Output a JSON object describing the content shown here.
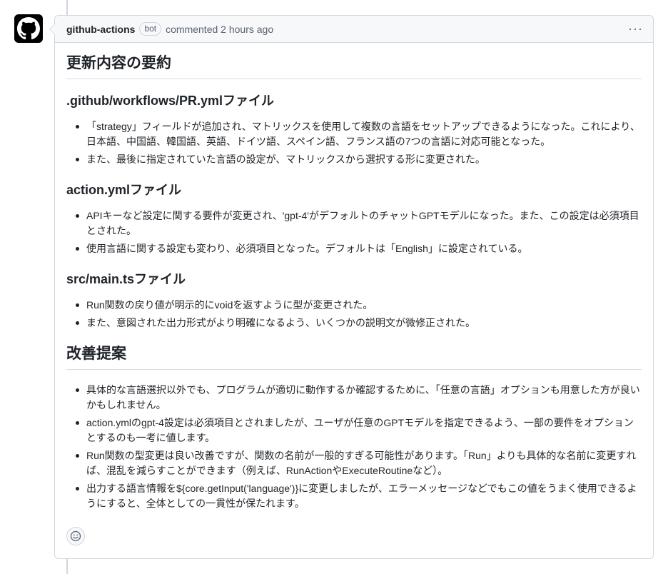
{
  "comment": {
    "author": "github-actions",
    "badge": "bot",
    "meta": "commented 2 hours ago",
    "menu_glyph": "···"
  },
  "icons": {
    "avatar": "github-mark-icon",
    "reaction": "smiley-icon"
  },
  "body": {
    "summary_heading": "更新内容の要約",
    "sections": [
      {
        "title": ".github/workflows/PR.ymlファイル",
        "items": [
          "「strategy」フィールドが追加され、マトリックスを使用して複数の言語をセットアップできるようになった。これにより、日本語、中国語、韓国語、英語、ドイツ語、スペイン語、フランス語の7つの言語に対応可能となった。",
          "また、最後に指定されていた言語の設定が、マトリックスから選択する形に変更された。"
        ]
      },
      {
        "title": "action.ymlファイル",
        "items": [
          "APIキーなど設定に関する要件が変更され、'gpt-4'がデフォルトのチャットGPTモデルになった。また、この設定は必須項目とされた。",
          "使用言語に関する設定も変わり、必須項目となった。デフォルトは「English」に設定されている。"
        ]
      },
      {
        "title": "src/main.tsファイル",
        "items": [
          "Run関数の戻り値が明示的にvoidを返すように型が変更された。",
          "また、意図された出力形式がより明確になるよう、いくつかの説明文が微修正された。"
        ]
      }
    ],
    "suggestions_heading": "改善提案",
    "suggestions": [
      "具体的な言語選択以外でも、プログラムが適切に動作するか確認するために、「任意の言語」オプションも用意した方が良いかもしれません。",
      "action.ymlのgpt-4設定は必須項目とされましたが、ユーザが任意のGPTモデルを指定できるよう、一部の要件をオプションとするのも一考に値します。",
      "Run関数の型変更は良い改善ですが、関数の名前が一般的すぎる可能性があります。「Run」よりも具体的な名前に変更すれば、混乱を減らすことができます（例えば、RunActionやExecuteRoutineなど）。",
      "出力する語言情報を${core.getInput('language')}に変更しましたが、エラーメッセージなどでもこの値をうまく使用できるようにすると、全体としての一貫性が保たれます。"
    ]
  }
}
